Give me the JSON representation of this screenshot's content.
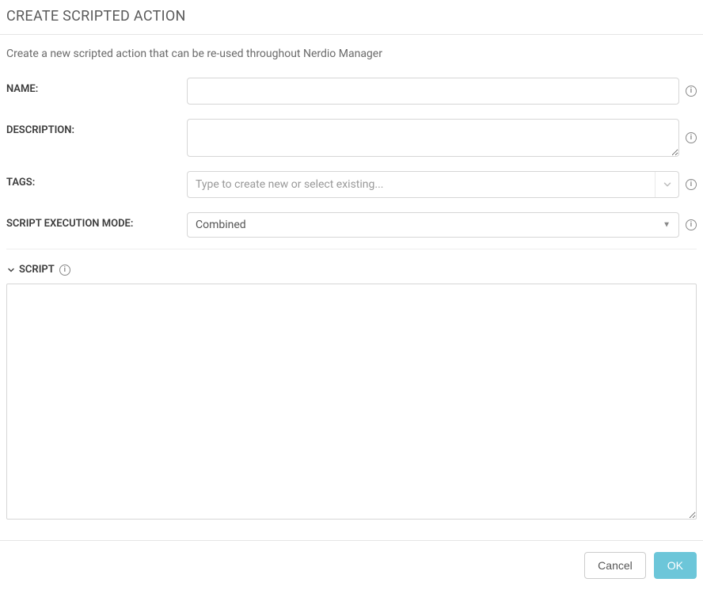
{
  "header": {
    "title": "CREATE SCRIPTED ACTION"
  },
  "subtitle": "Create a new scripted action that can be re-used throughout Nerdio Manager",
  "form": {
    "name_label": "NAME:",
    "name_value": "",
    "description_label": "DESCRIPTION:",
    "description_value": "",
    "tags_label": "TAGS:",
    "tags_placeholder": "Type to create new or select existing...",
    "exec_mode_label": "SCRIPT EXECUTION MODE:",
    "exec_mode_value": "Combined"
  },
  "script": {
    "section_label": "SCRIPT",
    "value": ""
  },
  "footer": {
    "cancel_label": "Cancel",
    "ok_label": "OK"
  }
}
